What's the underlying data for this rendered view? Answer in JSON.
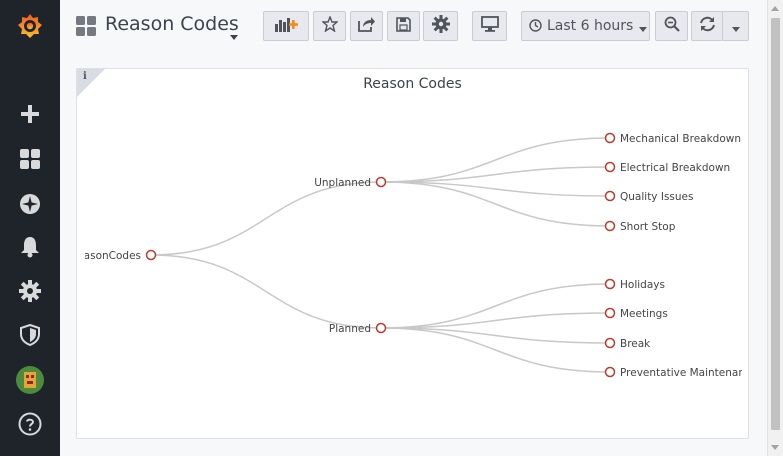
{
  "dashboard": {
    "title": "Reason Codes"
  },
  "toolbar": {
    "time_range": "Last 6 hours",
    "buttons": [
      "add-panel-icon",
      "star-icon",
      "share-icon",
      "save-icon",
      "gear-icon",
      "monitor-icon",
      "clock-icon",
      "zoom-out-icon",
      "refresh-icon",
      "caret-down-icon"
    ]
  },
  "panel": {
    "title": "Reason Codes",
    "info": "i"
  },
  "tree": {
    "root": "ReasonCodes",
    "branches": [
      {
        "label": "Unplanned",
        "children": [
          "Mechanical Breakdown",
          "Electrical Breakdown",
          "Quality Issues",
          "Short Stop"
        ]
      },
      {
        "label": "Planned",
        "children": [
          "Holidays",
          "Meetings",
          "Break",
          "Preventative Maintenance"
        ]
      }
    ],
    "colors": {
      "node_stroke": "#c0392b",
      "link": "#c8c8c8",
      "text": "#444444"
    }
  },
  "sidebar": {
    "items": [
      "grafana-logo-icon",
      "plus-icon",
      "dashboards-icon",
      "explore-icon",
      "bell-icon",
      "gear-icon",
      "shield-icon",
      "avatar",
      "help-icon"
    ]
  }
}
